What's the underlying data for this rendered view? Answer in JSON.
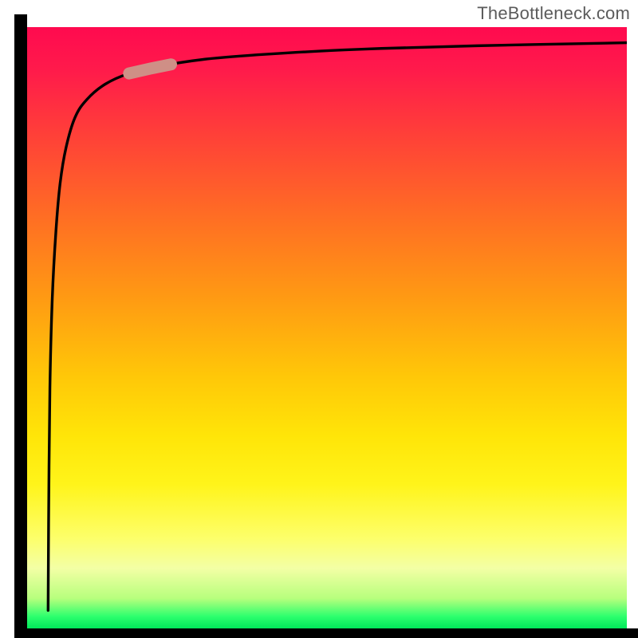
{
  "attribution": "TheBottleneck.com",
  "colors": {
    "axis": "#000000",
    "gradient_top": "#ff0a4f",
    "gradient_mid": "#ffe508",
    "gradient_bottom": "#00e85a",
    "curve": "#000000",
    "highlight": "#cf8f86"
  },
  "chart_data": {
    "type": "line",
    "title": "",
    "xlabel": "",
    "ylabel": "",
    "xlim": [
      0,
      100
    ],
    "ylim": [
      0,
      100
    ],
    "annotations": [
      {
        "text": "TheBottleneck.com",
        "position": "top-right"
      }
    ],
    "series": [
      {
        "name": "curve",
        "x": [
          3.5,
          3.6,
          3.8,
          4.2,
          4.8,
          5.5,
          6.5,
          8,
          10,
          13,
          17,
          22,
          30,
          40,
          55,
          75,
          100
        ],
        "y": [
          3,
          20,
          40,
          55,
          66,
          74,
          80,
          85,
          88,
          90.5,
          92.3,
          93.5,
          94.7,
          95.5,
          96.3,
          96.9,
          97.4
        ]
      }
    ],
    "highlight_segment": {
      "series": "curve",
      "x_start": 17,
      "x_end": 24,
      "style": "thick-rounded",
      "color": "#cf8f86"
    }
  }
}
